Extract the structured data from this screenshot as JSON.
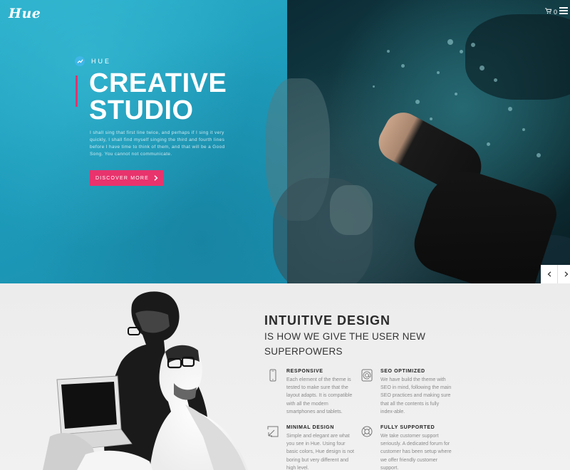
{
  "header": {
    "logo": "Hue",
    "cart_count": "0",
    "icons": {
      "cart": "cart-icon",
      "menu": "hamburger-menu-icon"
    }
  },
  "hero": {
    "badge": "HUE",
    "title_line1": "CREATIVE",
    "title_line2": "STUDIO",
    "description": "I shall sing that first line twice, and perhaps if I sing it very quickly, I shall find myself singing the third and fourth lines before I have time to think of them, and that will be a Good Song. You cannot not communicate.",
    "cta_label": "DISCOVER MORE",
    "accent_color": "#e8336d",
    "left_bg": "#1e9cbb"
  },
  "features_section": {
    "title": "INTUITIVE DESIGN",
    "subtitle": "IS HOW WE GIVE THE USER NEW SUPERPOWERS",
    "items": [
      {
        "icon": "smartphone-icon",
        "title": "RESPONSIVE",
        "text": "Each element of the theme is tested to make sure that the layout adapts. It is compatible with all the modern smartphones and tablets."
      },
      {
        "icon": "seo-at-icon",
        "title": "SEO OPTIMIZED",
        "text": "We have build the theme with SEO in mind, following the main SEO practices and making sure that all the contents is fully index-able."
      },
      {
        "icon": "minimal-arrow-icon",
        "title": "MINIMAL DESIGN",
        "text": "Simple and elegant are what you see in Hue. Using four basic colors, Hue design is not boring but very different and high level."
      },
      {
        "icon": "lifebuoy-icon",
        "title": "FULLY SUPPORTED",
        "text": "We take customer support seriously. A dedicated forum for customer has been setup where we offer  friendly customer support."
      }
    ]
  }
}
